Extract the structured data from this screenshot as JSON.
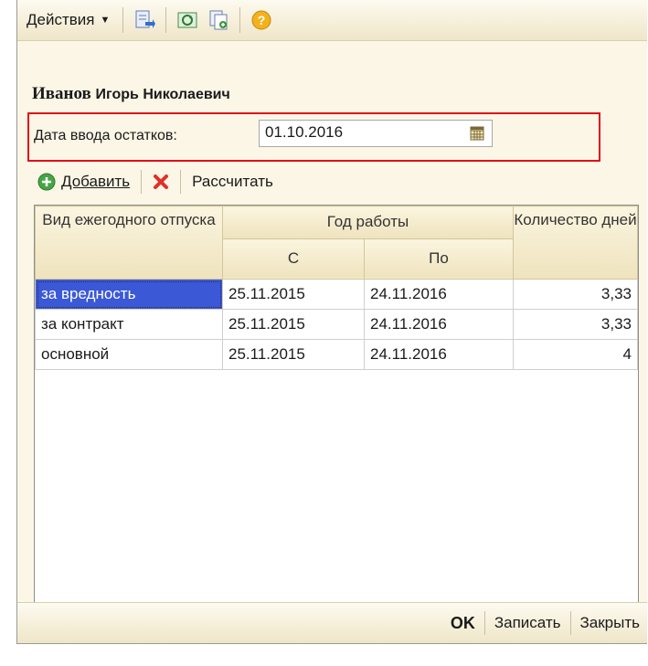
{
  "toolbar": {
    "actions_label": "Действия",
    "icons": [
      "move-down-icon",
      "refresh-icon",
      "copy-document-icon",
      "help-icon"
    ]
  },
  "header": {
    "last_name": "Иванов",
    "first_middle": "Игорь Николаевич"
  },
  "date_field": {
    "label": "Дата ввода остатков:",
    "value": "01.10.2016"
  },
  "actions": {
    "add_label": "Добавить",
    "calc_label": "Рассчитать"
  },
  "table": {
    "headers": {
      "type": "Вид ежегодного отпуска",
      "year": "Год работы",
      "from": "С",
      "to": "По",
      "days": "Количество дней"
    },
    "rows": [
      {
        "type": "за вредность",
        "from": "25.11.2015",
        "to": "24.11.2016",
        "days": "3,33"
      },
      {
        "type": "за контракт",
        "from": "25.11.2015",
        "to": "24.11.2016",
        "days": "3,33"
      },
      {
        "type": "основной",
        "from": "25.11.2015",
        "to": "24.11.2016",
        "days": "4"
      }
    ]
  },
  "footer": {
    "ok_label": "OK",
    "save_label": "Записать",
    "close_label": "Закрыть"
  },
  "colors": {
    "highlight": "#e0101a",
    "selection": "#3b58d6"
  }
}
